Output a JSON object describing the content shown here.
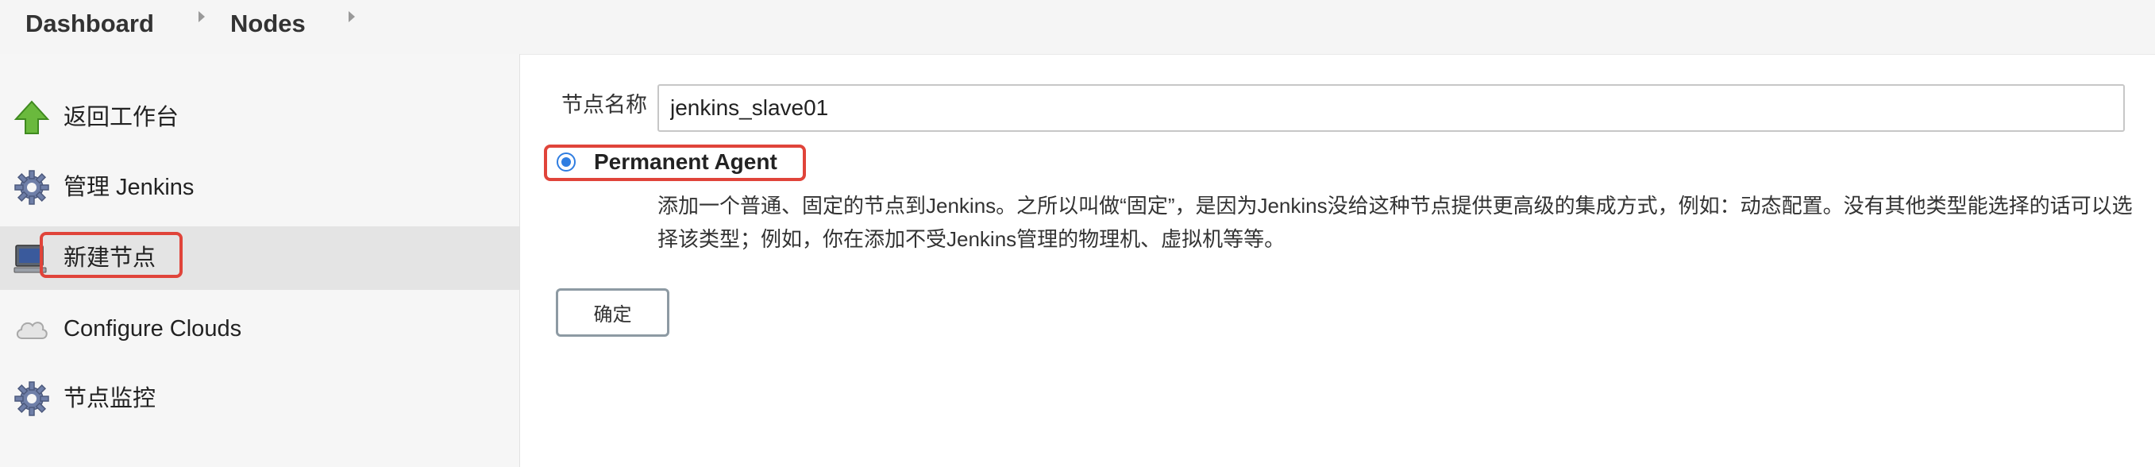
{
  "breadcrumb": {
    "items": [
      "Dashboard",
      "Nodes"
    ]
  },
  "sidebar": {
    "items": [
      {
        "label": "返回工作台",
        "icon": "up-arrow-icon"
      },
      {
        "label": "管理 Jenkins",
        "icon": "gear-icon"
      },
      {
        "label": "新建节点",
        "icon": "computer-icon",
        "active": true
      },
      {
        "label": "Configure Clouds",
        "icon": "cloud-icon"
      },
      {
        "label": "节点监控",
        "icon": "gear-icon"
      }
    ]
  },
  "form": {
    "node_name_label": "节点名称",
    "node_name_value": "jenkins_slave01",
    "agent_type_label": "Permanent Agent",
    "agent_type_selected": true,
    "agent_type_description": "添加一个普通、固定的节点到Jenkins。之所以叫做“固定”，是因为Jenkins没给这种节点提供更高级的集成方式，例如：动态配置。没有其他类型能选择的话可以选择该类型；例如，你在添加不受Jenkins管理的物理机、虚拟机等等。",
    "ok_label": "确定"
  },
  "colors": {
    "highlight": "#e0443a",
    "radio": "#2f7de1",
    "sidebar_bg": "#f6f6f6",
    "active_bg": "#e4e4e4"
  }
}
